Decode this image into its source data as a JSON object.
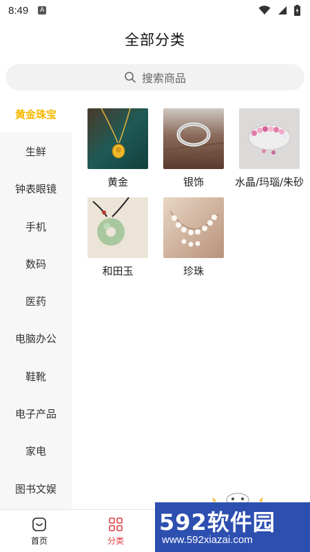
{
  "status_bar": {
    "time": "8:49",
    "notification_letter": "A"
  },
  "header": {
    "title": "全部分类"
  },
  "search": {
    "placeholder": "搜索商品"
  },
  "sidebar": {
    "items": [
      {
        "label": "黄金珠宝",
        "active": true
      },
      {
        "label": "生鲜"
      },
      {
        "label": "钟表眼镜"
      },
      {
        "label": "手机"
      },
      {
        "label": "数码"
      },
      {
        "label": "医药"
      },
      {
        "label": "电脑办公"
      },
      {
        "label": "鞋靴"
      },
      {
        "label": "电子产品"
      },
      {
        "label": "家电"
      },
      {
        "label": "图书文娱"
      }
    ]
  },
  "categories": [
    {
      "label": "黄金",
      "image": "gold-necklace"
    },
    {
      "label": "银饰",
      "image": "silver-ring"
    },
    {
      "label": "水晶/玛瑙/朱砂",
      "image": "crystal-bracelet"
    },
    {
      "label": "和田玉",
      "image": "jade-pendant"
    },
    {
      "label": "珍珠",
      "image": "pearl-necklace"
    }
  ],
  "bottom_nav": {
    "items": [
      {
        "label": "首页",
        "icon": "home-icon"
      },
      {
        "label": "分类",
        "icon": "category-icon",
        "active": true
      }
    ]
  },
  "watermark": {
    "brand": "592软件园",
    "url": "www.592xiazai.com"
  },
  "colors": {
    "accent": "#f5b800",
    "nav_active": "#e23b3b",
    "watermark_bg": "#2d4fb0"
  }
}
